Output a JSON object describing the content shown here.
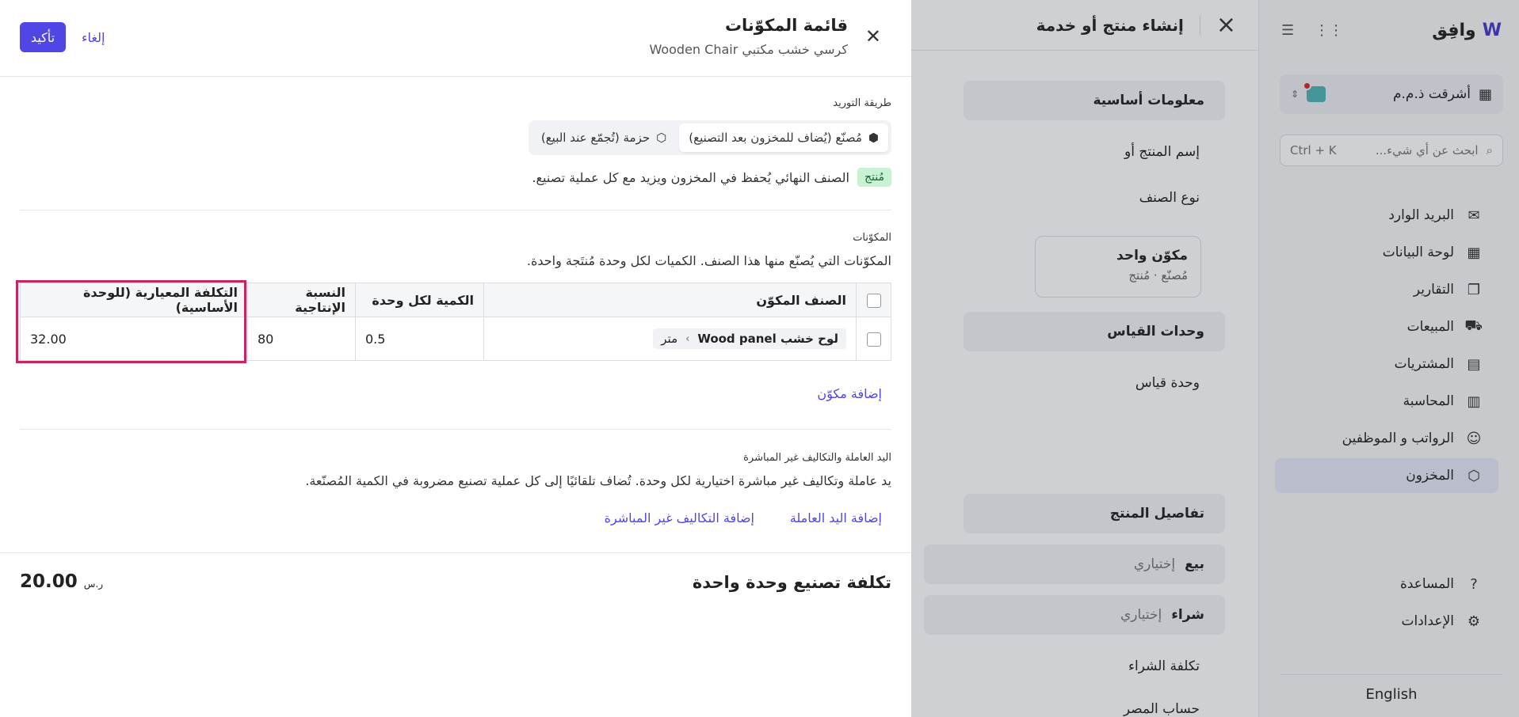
{
  "sidebar": {
    "brand": "وافِق",
    "org_name": "أشرقت ذ.م.م",
    "search_placeholder": "ابحث عن أي شيء...",
    "search_shortcut": "Ctrl + K",
    "nav": [
      {
        "label": "البريد الوارد",
        "icon": "inbox-icon"
      },
      {
        "label": "لوحة البيانات",
        "icon": "dashboard-icon"
      },
      {
        "label": "التقارير",
        "icon": "reports-icon"
      },
      {
        "label": "المبيعات",
        "icon": "cart-icon"
      },
      {
        "label": "المشتريات",
        "icon": "receipt-icon"
      },
      {
        "label": "المحاسبة",
        "icon": "ledger-icon"
      },
      {
        "label": "الرواتب و الموظفين",
        "icon": "people-icon"
      },
      {
        "label": "المخزون",
        "icon": "box-icon",
        "active": true
      }
    ],
    "help_label": "المساعدة",
    "settings_label": "الإعدادات",
    "language": "English"
  },
  "form": {
    "title": "إنشاء منتج أو خدمة",
    "section_basic": "معلومات أساسية",
    "name_label": "إسم المنتج أو",
    "type_label": "نوع الصنف",
    "card_title": "مكوّن واحد",
    "card_sub": "مُصنّع · مُنتج",
    "section_units": "وحدات القياس",
    "unit_label": "وحدة قياس",
    "section_details": "تفاصيل المنتج",
    "sell_key": "بيع",
    "sell_val": "إختياري",
    "buy_key": "شراء",
    "buy_val": "إختياري",
    "purchase_cost": "تكلفة الشراء",
    "expense_account": "حساب المصر"
  },
  "bom": {
    "title": "قائمة المكوّنات",
    "subtitle": "كرسي خشب مكتبي Wooden Chair",
    "confirm_label": "تأكيد",
    "cancel_label": "إلغاء",
    "supply_caption": "طريقة التوريد",
    "supply_options": [
      {
        "label": "مُصنّع (يُضاف للمخزون بعد التصنيع)",
        "selected": true
      },
      {
        "label": "حزمة (تُجمّع عند البيع)",
        "selected": false
      }
    ],
    "badge": "مُنتج",
    "badge_desc": "الصنف النهائي يُحفظ في المخزون ويزيد مع كل عملية تصنيع.",
    "components_caption": "المكوّنات",
    "components_desc": "المكوّنات التي يُصنّع منها هذا الصنف. الكميات لكل وحدة مُنتَجة واحدة.",
    "columns": [
      "الصنف المكوّن",
      "الكمية لكل وحدة",
      "النسبة الإنتاجية",
      "التكلفة المعيارية (للوحدة الأساسية)"
    ],
    "rows": [
      {
        "item": "لوح خشب Wood panel",
        "unit": "متر",
        "qty": "0.5",
        "yield": "80",
        "cost": "32.00"
      }
    ],
    "add_component": "إضافة مكوّن",
    "labor_caption": "اليد العاملة والتكاليف غير المباشرة",
    "labor_desc": "يد عاملة وتكاليف غير مباشرة اختيارية لكل وحدة. تُضاف تلقائيًا إلى كل عملية تصنيع مضروبة في الكمية المُصنّعة.",
    "add_labor": "إضافة اليد العاملة",
    "add_overhead": "إضافة التكاليف غير المباشرة",
    "total_label": "تكلفة تصنيع وحدة واحدة",
    "total_value": "20.00",
    "currency": "ر.س"
  }
}
